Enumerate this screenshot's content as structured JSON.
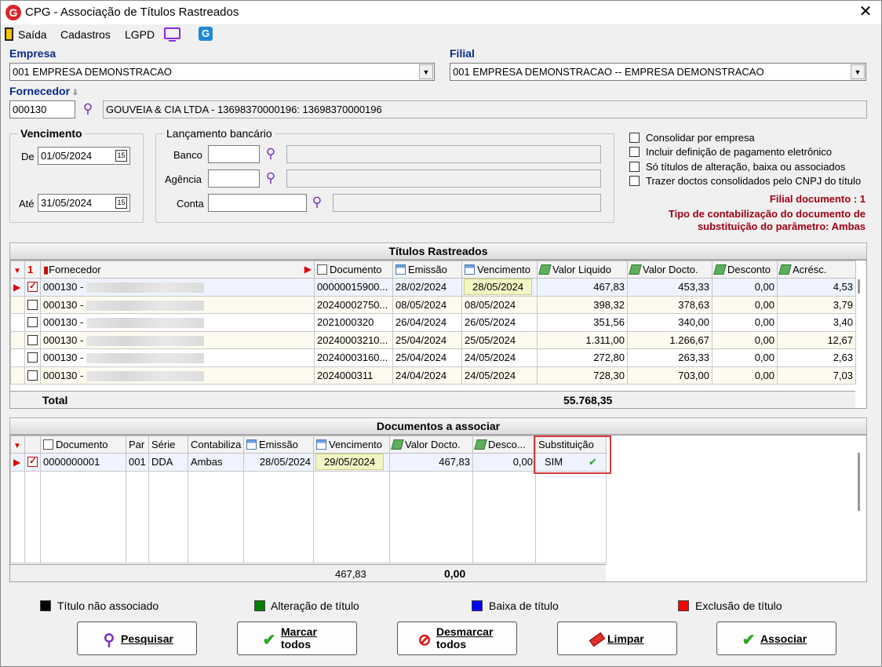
{
  "window": {
    "title": "CPG - Associação de Títulos Rastreados",
    "logo_letter": "G"
  },
  "menu": {
    "items": [
      "Saída",
      "Cadastros",
      "LGPD"
    ]
  },
  "empresa": {
    "label": "Empresa",
    "value": "001 EMPRESA DEMONSTRACAO"
  },
  "filial": {
    "label": "Filial",
    "value": "001 EMPRESA DEMONSTRACAO -- EMPRESA DEMONSTRACAO"
  },
  "fornecedor": {
    "label": "Fornecedor",
    "code": "000130",
    "desc": "GOUVEIA & CIA LTDA - 13698370000196: 13698370000196"
  },
  "vencimento": {
    "legend": "Vencimento",
    "de_label": "De",
    "de": "01/05/2024",
    "ate_label": "Até",
    "ate": "31/05/2024",
    "cal_glyph": "15"
  },
  "lancamento": {
    "legend": "Lançamento bancário",
    "banco_label": "Banco",
    "agencia_label": "Agência",
    "conta_label": "Conta"
  },
  "options": [
    {
      "label": "Consolidar por empresa",
      "checked": false
    },
    {
      "label": "Incluir definição de pagamento eletrônico",
      "checked": false
    },
    {
      "label": "Só títulos de alteração, baixa ou associados",
      "checked": false
    },
    {
      "label": "Trazer doctos consolidados pelo CNPJ do título",
      "checked": false
    }
  ],
  "notes": {
    "filial_documento": "Filial documento : 1",
    "tipo_line1": "Tipo de contabilização do documento de",
    "tipo_line2": "substituição do parâmetro: Ambas"
  },
  "titulos": {
    "title": "Títulos Rastreados",
    "sort_index": "1",
    "columns": [
      "Fornecedor",
      "Documento",
      "Emissão",
      "Vencimento",
      "Valor Liquido",
      "Valor Docto.",
      "Desconto",
      "Acrésc."
    ],
    "rows": [
      {
        "checked": true,
        "current": true,
        "fornecedor": "000130 -",
        "documento": "00000015900...",
        "emissao": "28/02/2024",
        "vencimento": "28/05/2024",
        "liquido": "467,83",
        "docto": "453,33",
        "desconto": "0,00",
        "acresc": "4,53"
      },
      {
        "checked": false,
        "current": false,
        "fornecedor": "000130 -",
        "documento": "20240002750...",
        "emissao": "08/05/2024",
        "vencimento": "08/05/2024",
        "liquido": "398,32",
        "docto": "378,63",
        "desconto": "0,00",
        "acresc": "3,79"
      },
      {
        "checked": false,
        "current": false,
        "fornecedor": "000130 -",
        "documento": "2021000320",
        "emissao": "26/04/2024",
        "vencimento": "26/05/2024",
        "liquido": "351,56",
        "docto": "340,00",
        "desconto": "0,00",
        "acresc": "3,40"
      },
      {
        "checked": false,
        "current": false,
        "fornecedor": "000130 -",
        "documento": "20240003210...",
        "emissao": "25/04/2024",
        "vencimento": "25/05/2024",
        "liquido": "1.311,00",
        "docto": "1.266,67",
        "desconto": "0,00",
        "acresc": "12,67"
      },
      {
        "checked": false,
        "current": false,
        "fornecedor": "000130 -",
        "documento": "20240003160...",
        "emissao": "25/04/2024",
        "vencimento": "24/05/2024",
        "liquido": "272,80",
        "docto": "263,33",
        "desconto": "0,00",
        "acresc": "2,63"
      },
      {
        "checked": false,
        "current": false,
        "fornecedor": "000130 -",
        "documento": "2024000311",
        "emissao": "24/04/2024",
        "vencimento": "24/05/2024",
        "liquido": "728,30",
        "docto": "703,00",
        "desconto": "0,00",
        "acresc": "7,03"
      }
    ],
    "total_label": "Total",
    "total_value": "55.768,35"
  },
  "documentos": {
    "title": "Documentos a associar",
    "columns": [
      "Documento",
      "Par",
      "Série",
      "Contabiliza",
      "Emissão",
      "Vencimento",
      "Valor Docto.",
      "Desco...",
      "Substituição"
    ],
    "rows": [
      {
        "checked": true,
        "documento": "0000000001",
        "par": "001",
        "serie": "DDA",
        "contabiliza": "Ambas",
        "emissao": "28/05/2024",
        "vencimento": "29/05/2024",
        "valor": "467,83",
        "desconto": "0,00",
        "substituicao": "SIM"
      }
    ],
    "footer_valor": "467,83",
    "footer_desconto": "0,00"
  },
  "legend": [
    {
      "label": "Título não associado",
      "color": "#000000"
    },
    {
      "label": "Alteração de título",
      "color": "#008000"
    },
    {
      "label": "Baixa de título",
      "color": "#0000ff"
    },
    {
      "label": "Exclusão de título",
      "color": "#ff0000"
    }
  ],
  "buttons": {
    "pesquisar": "Pesquisar",
    "marcar_1": "Marcar",
    "marcar_2": "todos",
    "desmarcar_1": "Desmarcar",
    "desmarcar_2": "todos",
    "limpar": "Limpar",
    "associar": "Associar"
  }
}
